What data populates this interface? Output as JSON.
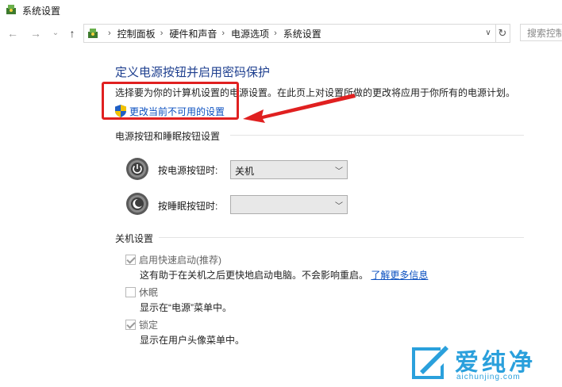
{
  "window": {
    "title": "系统设置"
  },
  "nav": {
    "back_icon": "arrow-left-icon",
    "forward_icon": "arrow-right-icon",
    "recent_icon": "chevron-down-icon",
    "up_icon": "arrow-up-icon",
    "breadcrumbs": [
      "控制面板",
      "硬件和声音",
      "电源选项",
      "系统设置"
    ],
    "search_placeholder": "搜索控制"
  },
  "page": {
    "heading": "定义电源按钮并启用密码保护",
    "description": "选择要为你的计算机设置的电源设置。在此页上对设置所做的更改将应用于你所有的电源计划。",
    "change_link": "更改当前不可用的设置"
  },
  "power_section": {
    "title": "电源按钮和睡眠按钮设置",
    "power_button_label": "按电源按钮时:",
    "power_button_value": "关机",
    "sleep_button_label": "按睡眠按钮时:",
    "sleep_button_value": ""
  },
  "shutdown_section": {
    "title": "关机设置",
    "fast_startup": {
      "label": "启用快速启动(推荐)",
      "checked": true,
      "desc": "这有助于在关机之后更快地启动电脑。不会影响重启。",
      "link": "了解更多信息"
    },
    "hibernate": {
      "label": "休眠",
      "checked": false,
      "desc": "显示在“电源”菜单中。"
    },
    "lock": {
      "label": "锁定",
      "checked": true,
      "desc": "显示在用户头像菜单中。"
    }
  },
  "watermark": {
    "cn": "爱纯净",
    "en": "aichunjing.com"
  },
  "colors": {
    "heading": "#1e3f8f",
    "link": "#0b50c0",
    "annotation": "#e02020",
    "watermark": "#2aa0dc"
  }
}
